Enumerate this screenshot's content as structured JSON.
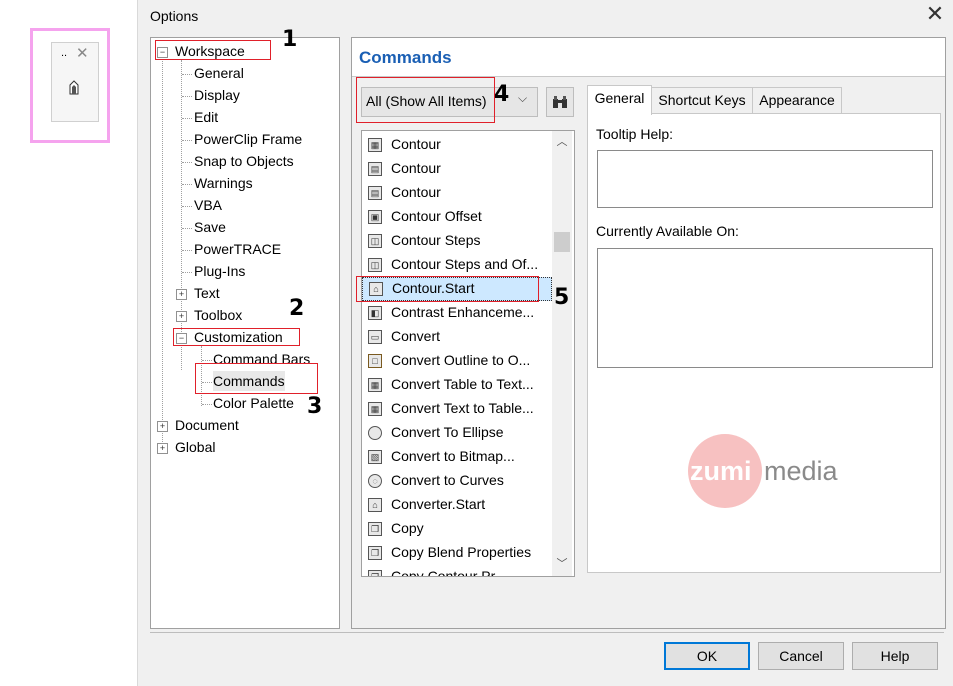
{
  "dialog": {
    "title": "Options"
  },
  "tree": {
    "workspace": "Workspace",
    "workspace_children": [
      "General",
      "Display",
      "Edit",
      "PowerClip Frame",
      "Snap to Objects",
      "Warnings",
      "VBA",
      "Save",
      "PowerTRACE",
      "Plug-Ins"
    ],
    "text": "Text",
    "toolbox": "Toolbox",
    "customization": "Customization",
    "customization_children": [
      "Command Bars",
      "Commands",
      "Color Palette"
    ],
    "document": "Document",
    "global": "Global"
  },
  "annotations": [
    "1",
    "2",
    "3",
    "4",
    "5"
  ],
  "pane": {
    "title": "Commands",
    "filter_value": "All (Show All Items)",
    "commands": [
      "Contour",
      "Contour",
      "Contour",
      "Contour Offset",
      "Contour Steps",
      "Contour Steps and Of...",
      "Contour.Start",
      "Contrast Enhanceme...",
      "Convert",
      "Convert Outline to O...",
      "Convert Table to Text...",
      "Convert Text to Table...",
      "Convert To Ellipse",
      "Convert to Bitmap...",
      "Convert to Curves",
      "Converter.Start",
      "Copy",
      "Copy Blend Properties",
      "Copy Contour Pr..."
    ],
    "selected_command": "Contour.Start",
    "tabs": [
      "General",
      "Shortcut Keys",
      "Appearance"
    ],
    "tooltip_label": "Tooltip Help:",
    "available_label": "Currently Available On:"
  },
  "watermark": {
    "left": "zumi",
    "right": "media"
  },
  "buttons": {
    "ok": "OK",
    "cancel": "Cancel",
    "help": "Help"
  },
  "mini_toolbar": {
    "handle": "..",
    "close": "✕"
  }
}
